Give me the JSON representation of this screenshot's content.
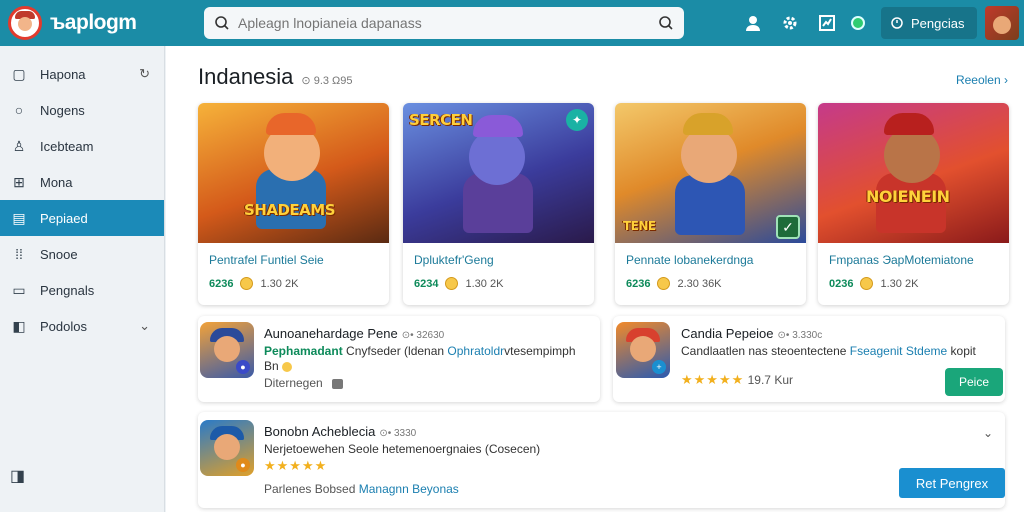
{
  "app": {
    "name": "ъaplogm"
  },
  "search": {
    "placeholder": "Apleagn lnopianeia dapanass"
  },
  "topbar": {
    "pill_label": "Pengcias"
  },
  "sidebar": {
    "items": [
      {
        "label": "Hapona",
        "icon": "square-frame-icon"
      },
      {
        "label": "Nogens",
        "icon": "circle-icon"
      },
      {
        "label": "Icebteam",
        "icon": "user-outline-icon"
      },
      {
        "label": "Mona",
        "icon": "grid-box-icon"
      },
      {
        "label": "Pepiaed",
        "icon": "document-icon",
        "active": true
      },
      {
        "label": "Snooe",
        "icon": "grid-dots-icon"
      },
      {
        "label": "Pengnals",
        "icon": "window-icon"
      },
      {
        "label": "Podolos",
        "icon": "box-icon"
      }
    ]
  },
  "main": {
    "title": "Indanesia",
    "title_meta": "⊙ 9.3 Ω95",
    "see_all": "Reeolen"
  },
  "cards": [
    {
      "title": "Pentrafel Funtiel Seie",
      "price": "6236",
      "count": "1.30 2K",
      "art_text": "SHADEAMS",
      "palette": [
        "#f08b2b",
        "#7a3a15"
      ]
    },
    {
      "title": "Dpluktefr'Geng",
      "price": "6234",
      "count": "1.30 2K",
      "art_text": "SERCEN",
      "palette": [
        "#3a6fd8",
        "#2a2060"
      ]
    },
    {
      "title": "Pennate lobanekerdnga",
      "price": "6236",
      "count": "2.30 36K",
      "art_text": "TENE",
      "palette": [
        "#e99a2a",
        "#1d3c8c"
      ]
    },
    {
      "title": "Fmpanas ЭapMotemiatone",
      "price": "0236",
      "count": "1.30 2K",
      "art_text": "NOIENEIN",
      "palette": [
        "#c23a8a",
        "#d8402e"
      ]
    }
  ],
  "list": [
    {
      "title": "Aunoanehardage Pene",
      "title_meta": "⊙• 32630",
      "line1_green": "Pephamadant",
      "line1_mid": " Cnyfseder (ldenan ",
      "line1_blue": "Ophratoldr",
      "line1_end": "vtesempimph",
      "line2": "Bn",
      "line3": "Diternegen"
    },
    {
      "title": "Candia Pepeioe",
      "title_meta": "⊙• 3.330c",
      "line1": "Candlaatlen nas steoentectene ",
      "line1_blue": "Fseagenit Stdeme",
      "line1_end": " kopit",
      "rating_stars": "★★★★★",
      "rating_text": "19.7 Kur",
      "button": "Peice"
    },
    {
      "title": "Bonobn Acheblecia",
      "title_meta": "⊙• 3330",
      "line1": "Nerjetoewehen Seole hetemenoergnaies (Cosecen)",
      "rating_stars": "★★★★★",
      "line3_grey": "Parlenes Bobsed ",
      "line3_blue": "Managnn Beyonas",
      "button": "Ret Pengrex"
    }
  ]
}
